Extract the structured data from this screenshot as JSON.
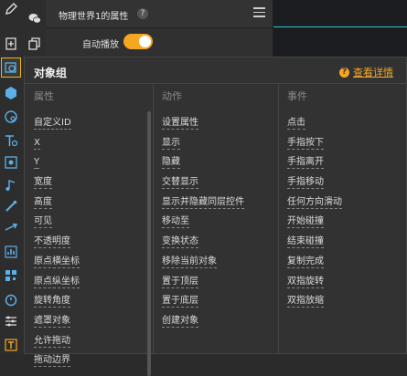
{
  "properties_panel": {
    "title": "物理世界1的属性",
    "help": "?",
    "auto_play_label": "自动播放",
    "auto_play_on": true
  },
  "popup": {
    "title": "对象组",
    "help_label": "查看详情",
    "columns": [
      {
        "header": "属性",
        "items": [
          "自定义ID",
          "X",
          "Y",
          "宽度",
          "高度",
          "可见",
          "不透明度",
          "原点横坐标",
          "原点纵坐标",
          "旋转角度",
          "遮罩对象",
          "允许拖动",
          "拖动边界"
        ]
      },
      {
        "header": "动作",
        "items": [
          "设置属性",
          "显示",
          "隐藏",
          "交替显示",
          "显示并隐藏同层控件",
          "移动至",
          "变换状态",
          "移除当前对象",
          "置于顶层",
          "置于底层",
          "创建对象"
        ]
      },
      {
        "header": "事件",
        "items": [
          "点击",
          "手指按下",
          "手指离开",
          "手指移动",
          "任何方向滑动",
          "开始碰撞",
          "结束碰撞",
          "复制完成",
          "双指旋转",
          "双指放缩"
        ]
      }
    ]
  },
  "colors": {
    "accent": "#f5a623",
    "canvas_line": "#2fc6c6",
    "active_outline": "#f5b800"
  },
  "icons": [
    "pencil-icon",
    "wechat-icon",
    "page-add-icon",
    "page-copy-icon",
    "image-group-icon",
    "hexagon-icon",
    "circle-search-icon",
    "text-icon",
    "audio-icon",
    "music-icon",
    "brush-icon",
    "arrow-icon",
    "chart-icon",
    "qr-icon",
    "timer-icon",
    "sliders-icon",
    "text-frame-icon"
  ]
}
